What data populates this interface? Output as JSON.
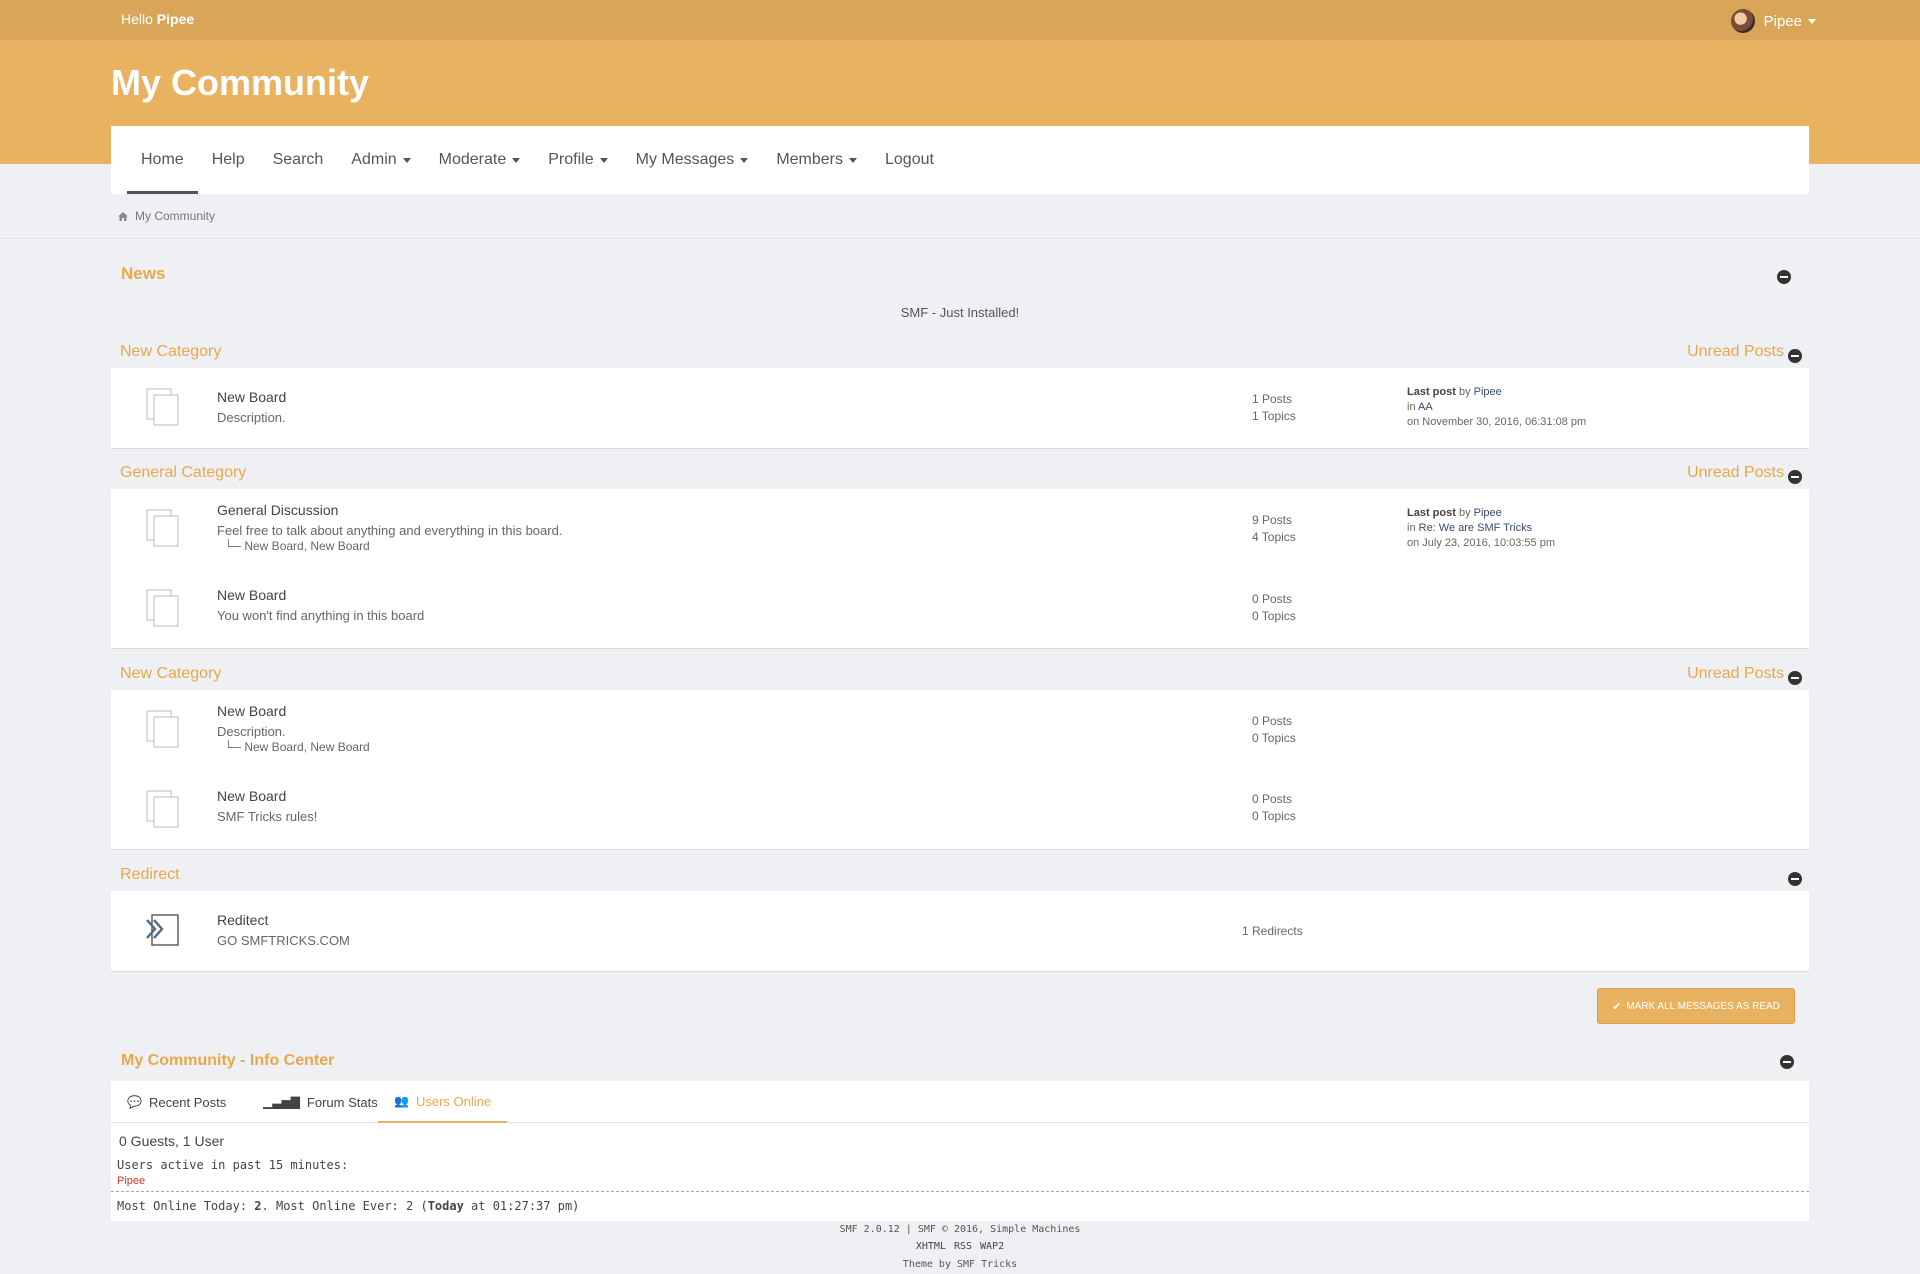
{
  "topbar": {
    "hello_prefix": "Hello",
    "hello_user": "Pipee",
    "user_menu": "Pipee"
  },
  "header": {
    "site_title": "My Community"
  },
  "nav": [
    "Home",
    "Help",
    "Search",
    "Admin",
    "Moderate",
    "Profile",
    "My Messages",
    "Members",
    "Logout"
  ],
  "breadcrumb": {
    "label": "My Community"
  },
  "news": {
    "title": "News",
    "text": "SMF - Just Installed!"
  },
  "unread_label": "Unread Posts",
  "categories": [
    {
      "title": "New Category",
      "boards": [
        {
          "name": "New Board",
          "desc": "Description.",
          "stats_line1": "1 Posts",
          "stats_line2": "1 Topics",
          "last_post_label": "Last post",
          "last_post_by": "by",
          "last_post_user": "Pipee",
          "last_post_in": "in",
          "last_post_topic": "AA",
          "last_post_date": "on November 30, 2016, 06:31:08 pm"
        }
      ]
    },
    {
      "title": "General Category",
      "boards": [
        {
          "name": "General Discussion",
          "desc": "Feel free to talk about anything and everything in this board.",
          "children": "New Board, New Board",
          "stats_line1": "9 Posts",
          "stats_line2": "4 Topics",
          "last_post_label": "Last post",
          "last_post_by": "by",
          "last_post_user": "Pipee",
          "last_post_in": "in",
          "last_post_topic": "Re: We are SMF Tricks",
          "last_post_date": "on July 23, 2016, 10:03:55 pm"
        },
        {
          "name": "New Board",
          "desc": "You won't find anything in this board",
          "stats_line1": "0 Posts",
          "stats_line2": "0 Topics"
        }
      ]
    },
    {
      "title": "New Category",
      "boards": [
        {
          "name": "New Board",
          "desc": "Description.",
          "children": "New Board, New Board",
          "stats_line1": "0 Posts",
          "stats_line2": "0 Topics"
        },
        {
          "name": "New Board",
          "desc": "SMF Tricks rules!",
          "stats_line1": "0 Posts",
          "stats_line2": "0 Topics"
        }
      ]
    },
    {
      "title": "Redirect",
      "boards": [
        {
          "name": "Reditect",
          "desc": "GO SMFTRICKS.COM",
          "stats_line1": "1 Redirects"
        }
      ]
    }
  ],
  "mark_all_button": "Mark all messages as read",
  "info_center": {
    "title": "My Community - Info Center",
    "tabs": [
      "Recent Posts",
      "Forum Stats",
      "Users Online"
    ],
    "online_count": "0 Guests, 1 User",
    "active_label": "Users active in past 15 minutes:",
    "online_user": "Pipee",
    "most_online_today_label": "Most Online Today:",
    "most_online_today_value": "2",
    "most_online_ever_label": ". Most Online Ever: 2 (",
    "most_online_ever_today": "Today",
    "most_online_ever_time": " at 01:27:37 pm)"
  },
  "footer": {
    "copyright": "SMF 2.0.12 | SMF © 2016, Simple Machines",
    "links": [
      "XHTML",
      "RSS",
      "WAP2"
    ],
    "theme": "Theme by SMF Tricks"
  },
  "colors": {
    "accent": "#e8b260",
    "topbar": "#d9a659",
    "category_text": "#e8a84a"
  }
}
